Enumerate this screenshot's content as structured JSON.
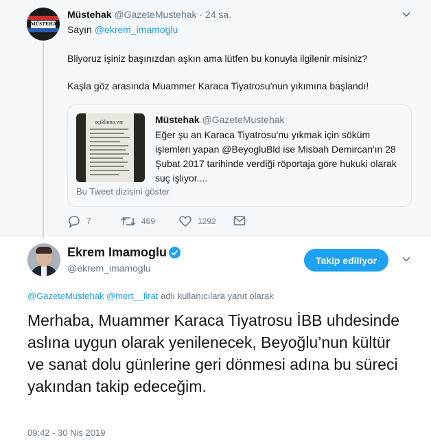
{
  "parent_tweet": {
    "author_name": "Müstehak",
    "author_handle": "@GazeteMustehak",
    "time": "· 24 sa.",
    "greeting": "Sayın",
    "greeting_mention": "@ekrem_imamoglu",
    "paragraph1": "Bliyoruz işiniz başınızdan aşkın ama lütfen bu konuyla ilgilenir misiniz?",
    "paragraph2": "Kaşla göz arasında Muammer Karaca Tiyatrosu'nun yıkımına başlandı!",
    "avatar_text": "MÜSTEHAK",
    "quoted": {
      "author_name": "Müstehak",
      "author_handle": "@GazeteMustehak",
      "text_part1": "Eğer şu an Karaca Tiyatrosu'nu yıkmak için söküm işlemleri yapan ",
      "text_mention": "@BeyogluBld",
      "text_part2": " ise Misbah Demircan'ın 28 Şubat 2017 tarihinde verdiği röportaja göre hukuki olarak suç işliyor....",
      "image_header": "açıklama var",
      "thread_link": "Bu Tweet dizisini göster"
    },
    "actions": {
      "replies": "7",
      "retweets": "469",
      "likes": "1292"
    }
  },
  "main_tweet": {
    "author_name": "Ekrem Imamoglu",
    "author_handle": "@ekrem_imamoglu",
    "follow_label": "Takip ediliyor",
    "reply_mention1": "@GazeteMustehak",
    "reply_mention2": "@mert__firat",
    "reply_suffix": " adlı kullanıcılara yanıt olarak",
    "text": "Merhaba, Muammer Karaca Tiyatrosu İBB uhdesinde aslına uygun olarak yenilenecek, Beyoğlu’nun kültür ve sanat dolu günlerine geri dönmesi adına bu süreci yakından takip edeceğim.",
    "timestamp": "09:42 - 30 Nis 2019"
  },
  "colors": {
    "accent": "#1da1f2",
    "secondary_text": "#657786",
    "parent_bg": "#f5f8fa"
  },
  "icons": [
    "caret-down-icon",
    "reply-icon",
    "retweet-icon",
    "like-icon",
    "message-icon",
    "verified-badge-icon"
  ]
}
